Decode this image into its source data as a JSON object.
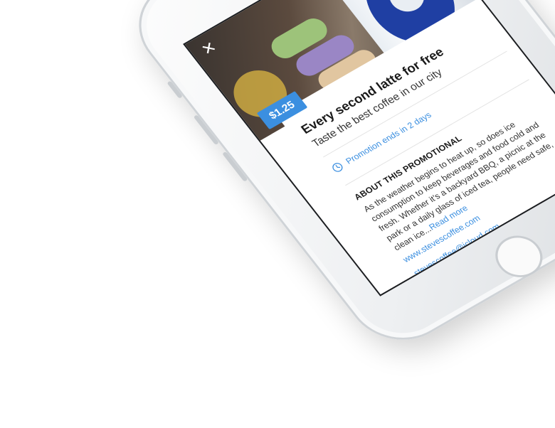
{
  "offer": {
    "price": "$1.25",
    "title": "Every second latte for free",
    "subtitle": "Taste the best coffee in our city",
    "promotion_status": "Promotion ends in 2 days"
  },
  "about": {
    "heading": "ABOUT THIS PROMOTIONAL",
    "body": "As the weather begins to heat up, so does ice consumption to keep beverages and food cold and fresh. Whether it's a backyard BBQ, a picnic at the park or a daily glass of iced tea, people need safe, clean ice...",
    "read_more": "Read more"
  },
  "contacts": {
    "website": "www.stevescoffee.com",
    "email": "stevescoffee@icloud.com"
  },
  "carousel": {
    "count": 5,
    "active_index": 0
  },
  "icons": {
    "close": "close-icon",
    "share": "share-icon",
    "favorite": "heart-icon",
    "clock": "clock-icon"
  },
  "colors": {
    "accent": "#3b8fe0",
    "heart": "#e53950",
    "cup_logo": "#1f3fa3"
  }
}
